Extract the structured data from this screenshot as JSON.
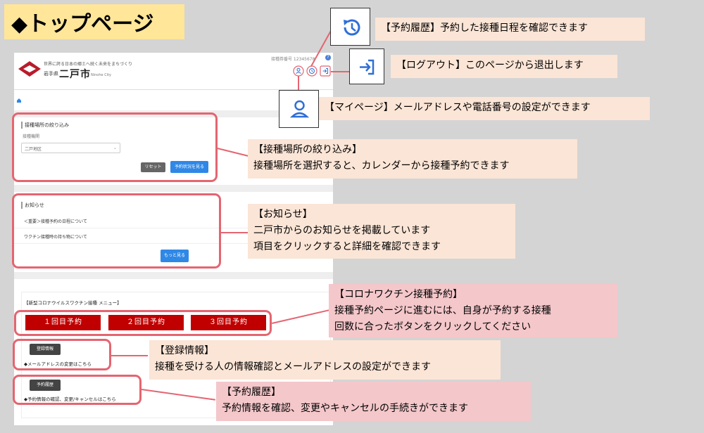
{
  "title": "◆トップページ",
  "screen": {
    "tagline": "世界に誇る日本の郷土へ続く未来をまちづくり",
    "pref": "岩手県",
    "city": "二戸市",
    "city_en": "Ninohe City",
    "user_no": "接種券番号 12345678",
    "help": "?",
    "filter_title": "接種場所の絞り込み",
    "filter_label": "接種機関",
    "filter_select": "二戸地区",
    "reset_label": "リセット",
    "view_status_label": "予約状況を見る",
    "news_title": "お知らせ",
    "news_items": [
      "＜重要＞接種予約の日程について",
      "ワクチン接種時の持ち物について"
    ],
    "more_label": "もっと見る",
    "menu_title": "【新型コロナウイルスワクチン接種 メニュー】",
    "dose_buttons": [
      "１回目予約",
      "２回目予約",
      "３回目予約"
    ],
    "reg_btn": "登録情報",
    "reg_desc": "◆メールアドレスの変更はこちら",
    "hist_btn": "予約履歴",
    "hist_desc": "◆予約情報の確認、変更/キャンセルはこちら"
  },
  "callouts": {
    "history": "【予約履歴】予約した接種日程を確認できます",
    "logout": "【ログアウト】このページから退出します",
    "mypage": "【マイページ】メールアドレスや電話番号の設定ができます",
    "filter": [
      "【接種場所の絞り込み】",
      "接種場所を選択すると、カレンダーから接種予約できます"
    ],
    "news": [
      "【お知らせ】",
      "二戸市からのお知らせを掲載しています",
      "項目をクリックすると詳細を確認できます"
    ],
    "vaccine": [
      "【コロナワクチン接種予約】",
      "接種予約ページに進むには、自身が予約する接種",
      "回数に合ったボタンをクリックしてください"
    ],
    "registration": [
      "【登録情報】",
      "接種を受ける人の情報確認とメールアドレスの設定ができます"
    ],
    "reservation": [
      "【予約履歴】",
      "予約情報を確認、変更やキャンセルの手続きができます"
    ]
  },
  "colors": {
    "accent_red": "#c00000",
    "highlight": "#e46570",
    "link_blue": "#2f88e6",
    "title_bg": "#ffe699"
  }
}
